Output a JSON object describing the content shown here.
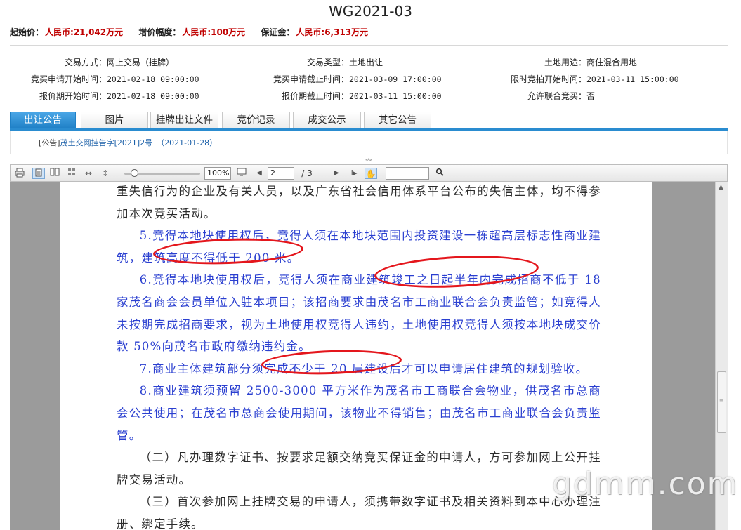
{
  "title": "WG2021-03",
  "prices": {
    "start_label": "起始价：",
    "start_value": "人民币:21,042万元",
    "step_label": "增价幅度：",
    "step_value": "人民币:100万元",
    "deposit_label": "保证金：",
    "deposit_value": "人民币:6,313万元"
  },
  "info": {
    "trade_mode_label": "交易方式：",
    "trade_mode_value": "网上交易（挂牌）",
    "trade_type_label": "交易类型：",
    "trade_type_value": "土地出让",
    "land_use_label": "土地用途：",
    "land_use_value": "商住混合用地",
    "apply_start_label": "竞买申请开始时间：",
    "apply_start_value": "2021-02-18 09:00:00",
    "apply_end_label": "竞买申请截止时间：",
    "apply_end_value": "2021-03-09 17:00:00",
    "auction_start_label": "限时竞拍开始时间：",
    "auction_start_value": "2021-03-11 15:00:00",
    "quote_start_label": "报价期开始时间：",
    "quote_start_value": "2021-02-18 09:00:00",
    "quote_end_label": "报价期截止时间：",
    "quote_end_value": "2021-03-11 15:00:00",
    "joint_label": "允许联合竞买：",
    "joint_value": "否"
  },
  "tabs": [
    "出让公告",
    "图片",
    "挂牌出让文件",
    "竞价记录",
    "成交公示",
    "其它公告"
  ],
  "announcement": {
    "tag": "[公告]",
    "link": "茂土交网挂告字[2021]2号",
    "date": "（2021-01-28）"
  },
  "toolbar": {
    "zoom": "100%",
    "page_current": "2",
    "page_total": "/ 3",
    "search_value": ""
  },
  "document": {
    "p1": "重失信行为的企业及有关人员，以及广东省社会信用体系平台公布的失信主体，均不得参加本次竞买活动。",
    "p5": "5.竞得本地块使用权后，竞得人须在本地块范围内投资建设一栋超高层标志性商业建筑，建筑高度不得低于 200 米。",
    "p6": "6.竞得本地块使用权后，竞得人须在商业建筑竣工之日起半年内完成招商不低于 18 家茂名商会会员单位入驻本项目；该招商要求由茂名市工商业联合会负责监管；如竞得人未按期完成招商要求，视为土地使用权竞得人违约，土地使用权竞得人须按本地块成交价款 50%向茂名市政府缴纳违约金。",
    "p7": "7.商业主体建筑部分须完成不少于 20 层建设后才可以申请居住建筑的规划验收。",
    "p8": "8.商业建筑须预留 2500-3000 平方米作为茂名市工商联合会物业，供茂名市总商会公共使用；在茂名市总商会使用期间，该物业不得销售；由茂名市工商业联合会负责监管。",
    "p9": "（二）凡办理数字证书、按要求足额交纳竞买保证金的申请人，方可参加网上公开挂牌交易活动。",
    "p10": "（三）首次参加网上挂牌交易的申请人，须携带数字证书及相关资料到本中心办理注册、绑定手续。"
  },
  "watermark": "gdmm.com"
}
